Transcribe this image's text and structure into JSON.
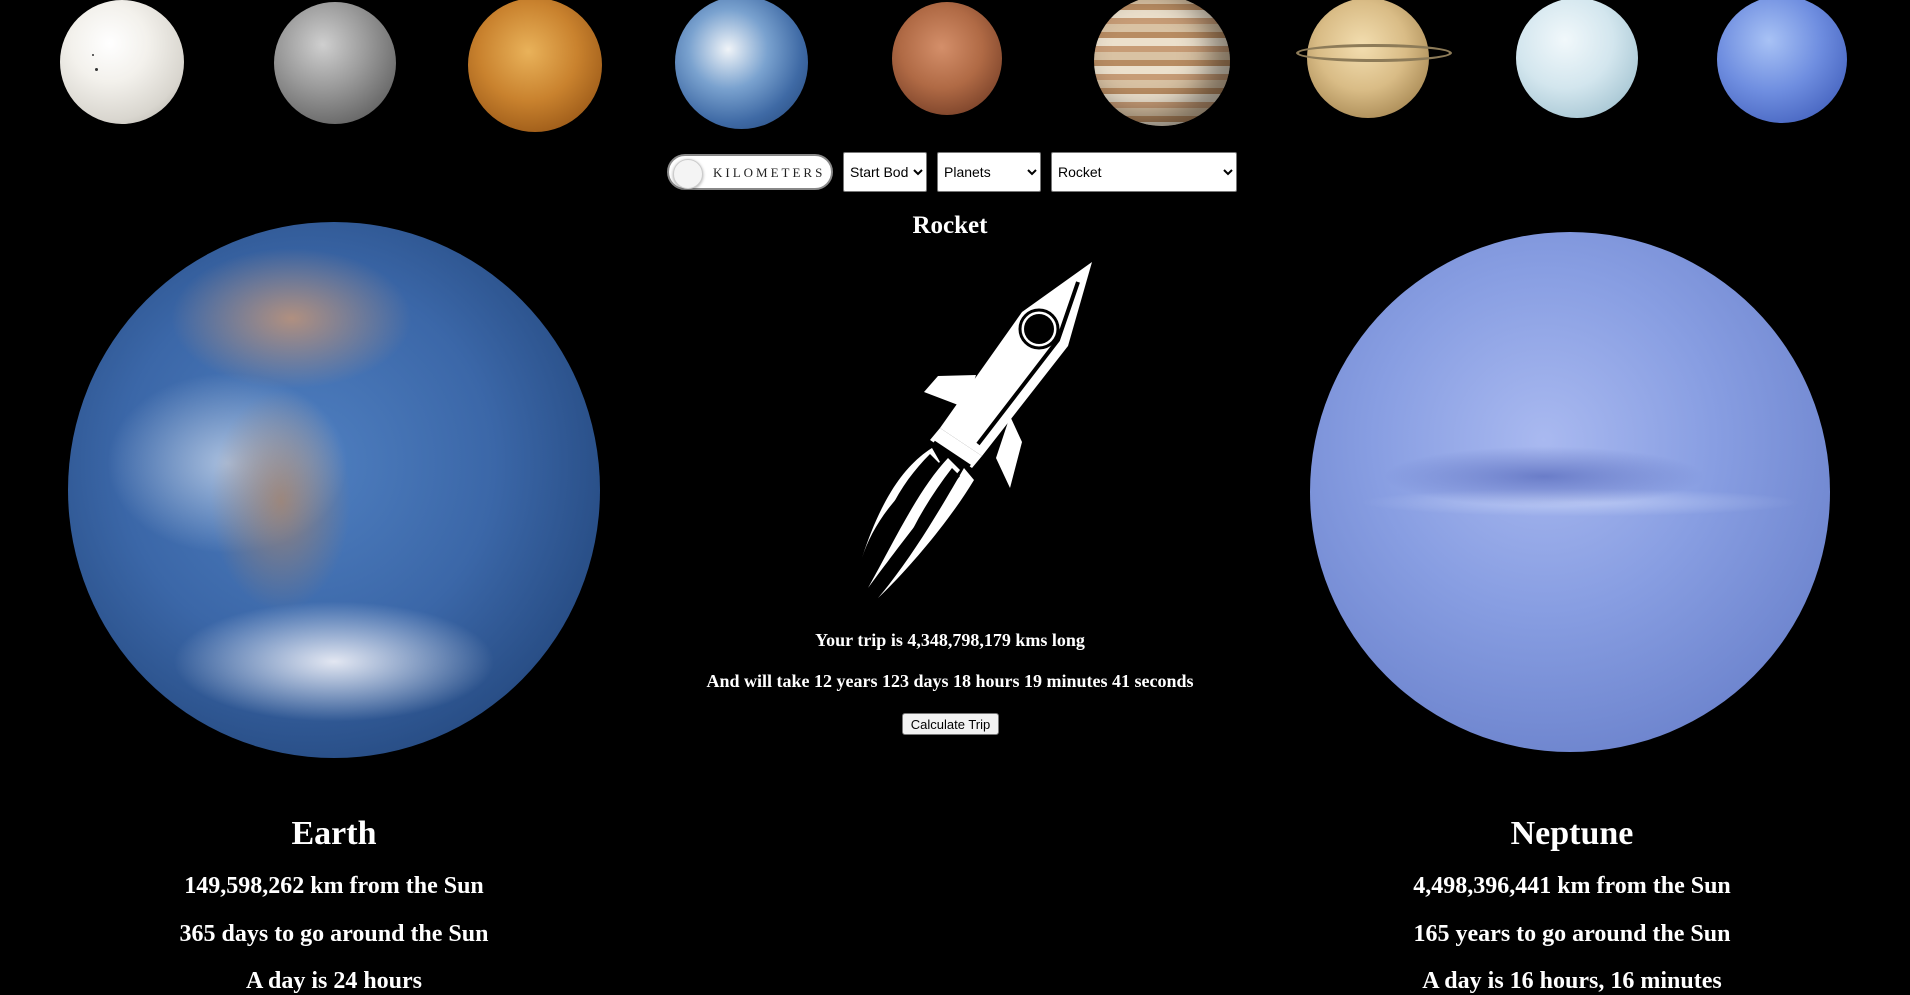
{
  "planet_strip": {
    "planets": [
      {
        "name": "sun-thumbnail"
      },
      {
        "name": "mercury-thumbnail"
      },
      {
        "name": "venus-thumbnail"
      },
      {
        "name": "earth-thumbnail"
      },
      {
        "name": "mars-thumbnail"
      },
      {
        "name": "jupiter-thumbnail"
      },
      {
        "name": "saturn-thumbnail"
      },
      {
        "name": "uranus-thumbnail"
      },
      {
        "name": "neptune-thumbnail"
      }
    ]
  },
  "controls": {
    "unit_toggle_label": "KILOMETERS",
    "start_body_selected": "Start Body",
    "body_type_selected": "Planets",
    "vehicle_selected": "Rocket"
  },
  "vehicle": {
    "title": "Rocket",
    "icon": "rocket-icon"
  },
  "trip": {
    "distance_text": "Your trip is 4,348,798,179 kms long",
    "duration_text": "And will take 12 years 123 days 18 hours 19 minutes 41 seconds",
    "calculate_label": "Calculate Trip"
  },
  "origin": {
    "name": "Earth",
    "distance": "149,598,262 km from the Sun",
    "orbit": "365 days to go around the Sun",
    "day": "A day is 24 hours"
  },
  "destination": {
    "name": "Neptune",
    "distance": "4,498,396,441 km from the Sun",
    "orbit": "165 years to go around the Sun",
    "day": "A day is 16 hours, 16 minutes"
  },
  "colors": {
    "background": "#000000",
    "text": "#ffffff"
  }
}
